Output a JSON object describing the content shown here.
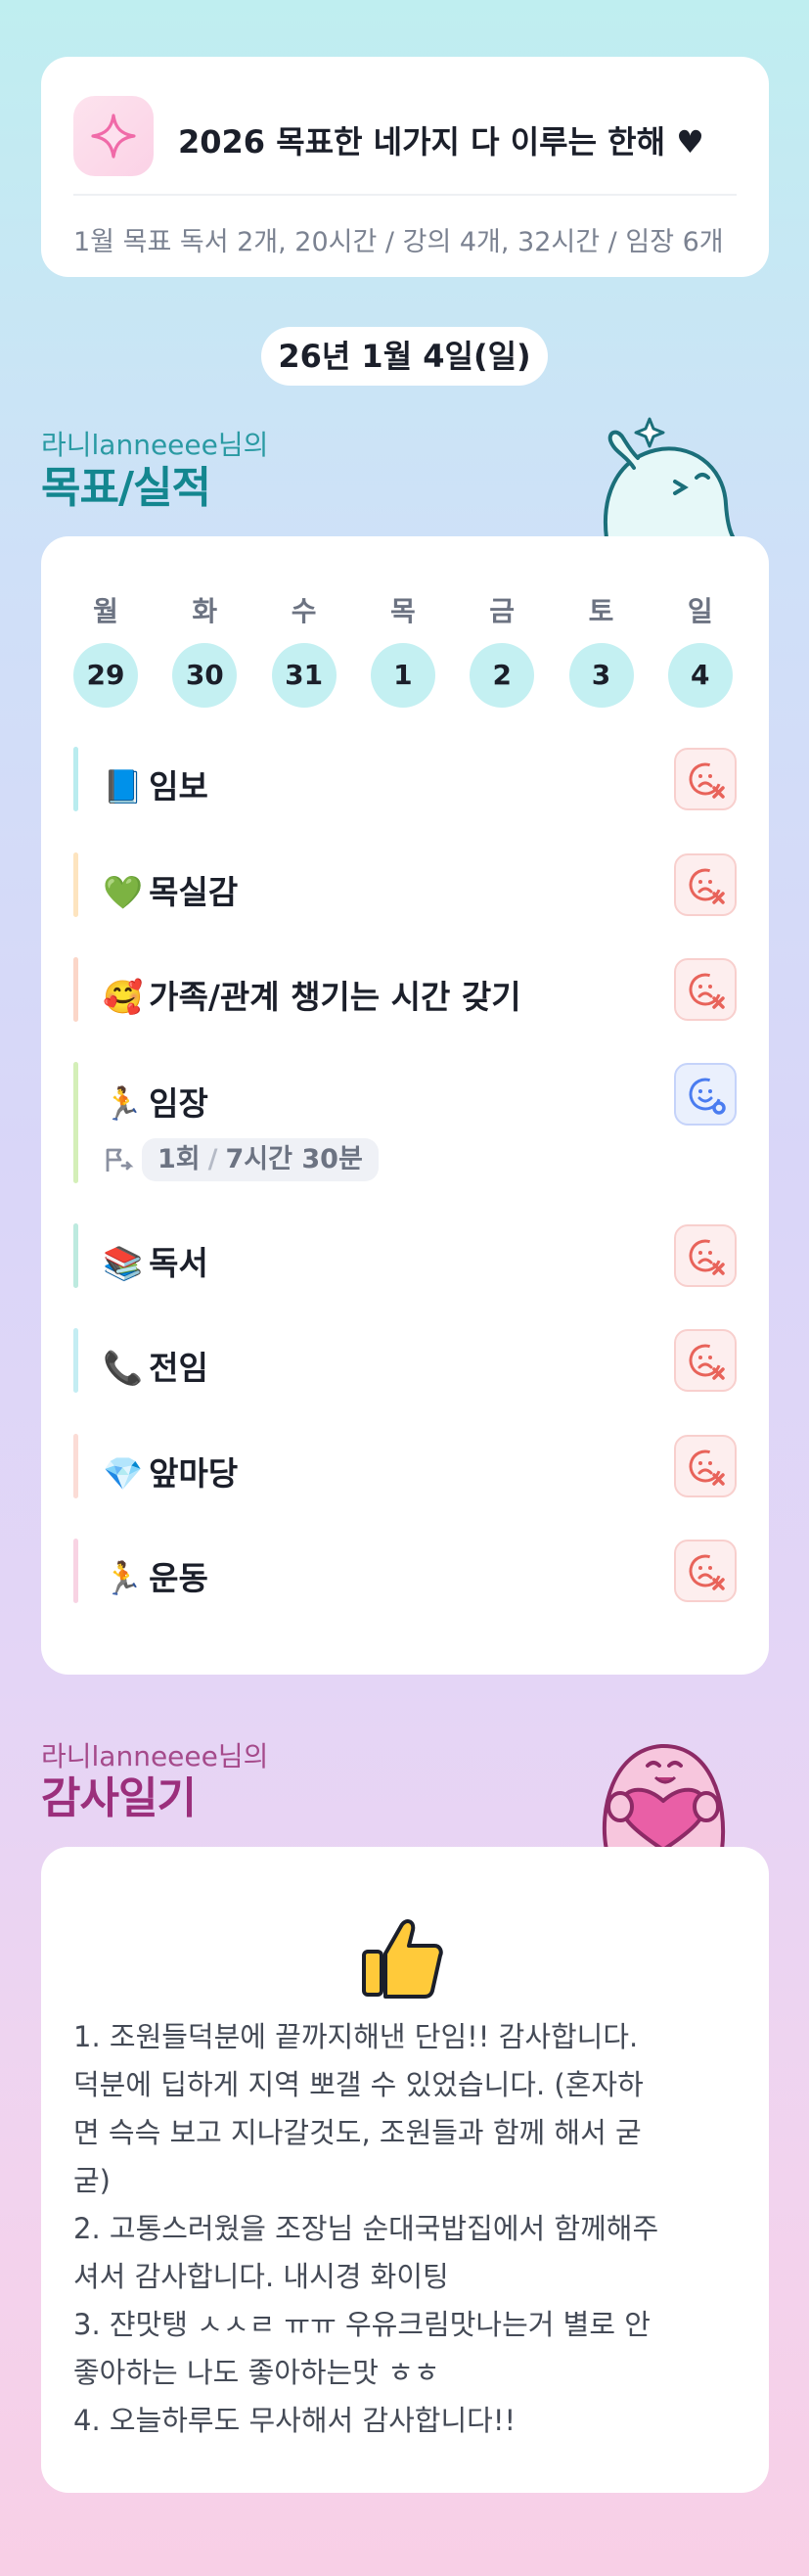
{
  "goal_card": {
    "title": "2026 목표한 네가지 다 이루는 한해 ♥",
    "subtitle": "1월 목표  독서 2개, 20시간 / 강의 4개, 32시간 / 임장 6개"
  },
  "date_label": "26년 1월 4일(일)",
  "goals_section": {
    "subtitle": "라니lanneeee님의",
    "title": "목표/실적"
  },
  "week": [
    {
      "label": "월",
      "num": "29"
    },
    {
      "label": "화",
      "num": "30"
    },
    {
      "label": "수",
      "num": "31"
    },
    {
      "label": "목",
      "num": "1"
    },
    {
      "label": "금",
      "num": "2"
    },
    {
      "label": "토",
      "num": "3"
    },
    {
      "label": "일",
      "num": "4"
    }
  ],
  "goals": [
    {
      "emoji": "📘",
      "name": "임보",
      "status": "fail",
      "bar_color": "#b9ecef"
    },
    {
      "emoji": "💚",
      "name": "목실감",
      "status": "fail",
      "bar_color": "#fde4bf"
    },
    {
      "emoji": "🥰",
      "name": "가족/관계 챙기는 시간 갖기",
      "status": "fail",
      "bar_color": "#fbd6c8"
    },
    {
      "emoji": "🏃",
      "name": "임장",
      "status": "ok",
      "bar_color": "#d4efb8",
      "session": {
        "count": "1회",
        "sep": "/",
        "time": "7시간 30분"
      }
    },
    {
      "emoji": "📚",
      "name": "독서",
      "status": "fail",
      "bar_color": "#bdeadf"
    },
    {
      "emoji": "📞",
      "name": "전임",
      "status": "fail",
      "bar_color": "#c4edf3"
    },
    {
      "emoji": "💎",
      "name": "앞마당",
      "status": "fail",
      "bar_color": "#fbdcd6"
    },
    {
      "emoji": "🏃",
      "name": "운동",
      "status": "fail",
      "bar_color": "#f8d3e3"
    }
  ],
  "thanks_section": {
    "subtitle": "라니lanneeee님의",
    "title": "감사일기"
  },
  "thanks_lines": [
    "1. 조원들덕분에 끝까지해낸 단임!! 감사합니다.",
    "덕분에 딥하게 지역 뽀갤 수 있었습니다. (혼자하",
    "면 슥슥 보고 지나갈것도, 조원들과 함께 해서 굳",
    "굳)",
    "2. 고통스러웠을 조장님 순대국밥집에서 함께해주",
    "셔서 감사합니다. 내시경 화이팅",
    "3. 쟌맛탱 ㅅㅅㄹ ㅠㅠ 우유크림맛나는거 별로 안",
    "좋아하는 나도 좋아하는맛 ㅎㅎ",
    "4. 오늘하루도 무사해서 감사합니다!!"
  ],
  "colors": {
    "accent_teal": "#13868f",
    "accent_plum": "#9b2f7c",
    "fail_red": "#e8635a",
    "ok_blue": "#4a7cf0"
  }
}
